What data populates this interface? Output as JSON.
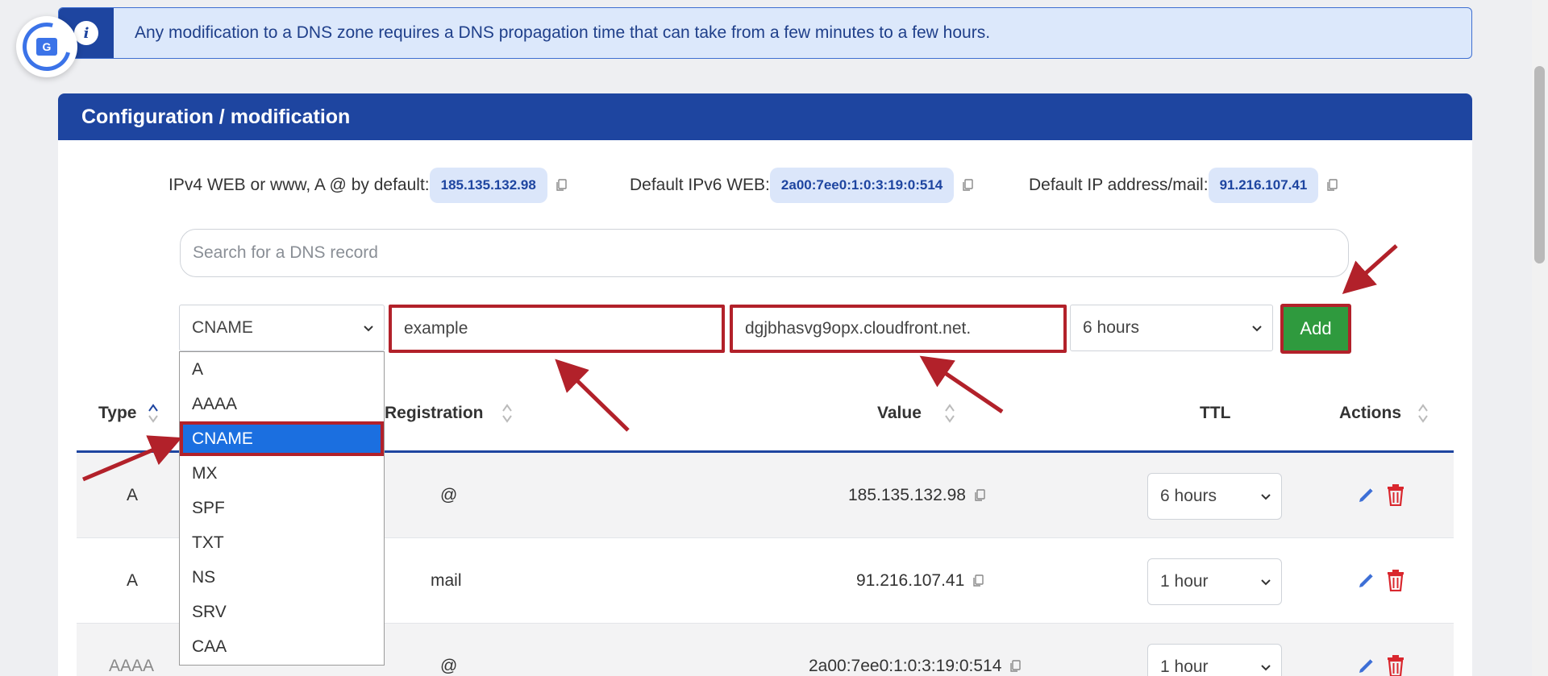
{
  "notice": {
    "text": "Any modification to a DNS zone requires a DNS propagation time that can take from a few minutes to a few hours."
  },
  "card": {
    "title": "Configuration / modification"
  },
  "defaults": {
    "ipv4_label": "IPv4 WEB or www, A @ by default:",
    "ipv4_value": "185.135.132.98",
    "ipv6_label": "Default IPv6 WEB:",
    "ipv6_value": "2a00:7ee0:1:0:3:19:0:514",
    "mail_label": "Default IP address/mail:",
    "mail_value": "91.216.107.41"
  },
  "search": {
    "placeholder": "Search for a DNS record"
  },
  "add_form": {
    "type_value": "CNAME",
    "name_value": "example",
    "value_value": "dgjbhasvg9opx.cloudfront.net.",
    "ttl_value": "6 hours",
    "add_label": "Add"
  },
  "type_options": [
    "A",
    "AAAA",
    "CNAME",
    "MX",
    "SPF",
    "TXT",
    "NS",
    "SRV",
    "CAA"
  ],
  "type_selected": "CNAME",
  "table": {
    "headers": {
      "type": "Type",
      "registration": "Registration",
      "value": "Value",
      "ttl": "TTL",
      "actions": "Actions"
    },
    "rows": [
      {
        "type": "A",
        "registration": "@",
        "value": "185.135.132.98",
        "ttl": "6 hours"
      },
      {
        "type": "A",
        "registration": "mail",
        "value": "91.216.107.41",
        "ttl": "1 hour"
      },
      {
        "type": "AAAA",
        "registration": "@",
        "value": "2a00:7ee0:1:0:3:19:0:514",
        "ttl": "1 hour"
      }
    ]
  },
  "colors": {
    "primary": "#1e45a0",
    "success": "#2f9a3e",
    "danger": "#d9272e",
    "highlight": "#b2212a",
    "selected": "#1b6fe0"
  },
  "icons": {
    "translate": "translate-icon",
    "info": "info-icon",
    "copy": "copy-icon",
    "sort": "sort-icon",
    "edit": "pencil-icon",
    "delete": "trash-icon",
    "chevron": "chevron-down-icon"
  }
}
